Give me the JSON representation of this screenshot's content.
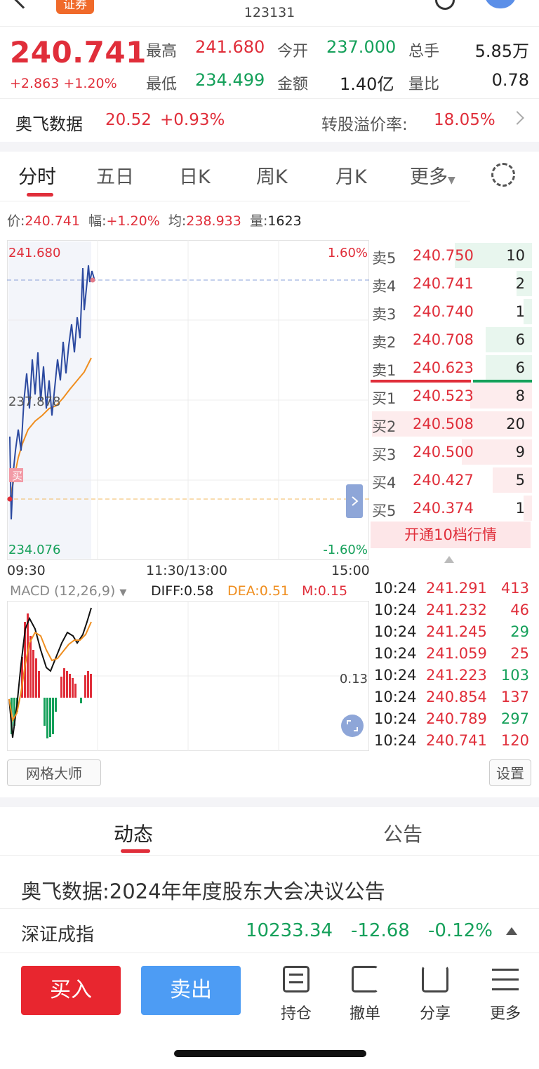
{
  "header": {
    "badge": "证券",
    "code": "123131"
  },
  "quote": {
    "price": "240.741",
    "change": "+2.863",
    "change_pct": "+1.20%",
    "high_label": "最高",
    "high": "241.680",
    "open_label": "今开",
    "open": "237.000",
    "vol_label": "总手",
    "vol": "5.85万",
    "low_label": "最低",
    "low": "234.499",
    "amt_label": "金额",
    "amt": "1.40亿",
    "ratio_label": "量比",
    "ratio": "0.78"
  },
  "underlying": {
    "name": "奥飞数据",
    "price": "20.52",
    "pct": "+0.93%",
    "premium_label": "转股溢价率:",
    "premium": "18.05%"
  },
  "tabs": [
    "分时",
    "五日",
    "日K",
    "周K",
    "月K",
    "更多"
  ],
  "info": {
    "price_label": "价:",
    "price": "240.741",
    "range_label": "幅:",
    "range": "+1.20%",
    "avg_label": "均:",
    "avg": "238.933",
    "vol_label": "量:",
    "vol": "1623"
  },
  "chart": {
    "top_price": "241.680",
    "top_pct": "1.60%",
    "mid_price": "237.878",
    "bottom_price": "234.076",
    "bottom_pct": "-1.60%",
    "buy_marker": "买",
    "t_start": "09:30",
    "t_mid": "11:30/13:00",
    "t_end": "15:00"
  },
  "macd": {
    "label": "MACD (12,26,9)",
    "diff": "DIFF:0.58",
    "dea": "DEA:0.51",
    "m": "M:0.15",
    "level": "0.13"
  },
  "orderbook": {
    "asks": [
      {
        "label": "卖5",
        "price": "240.750",
        "qty": "10"
      },
      {
        "label": "卖4",
        "price": "240.741",
        "qty": "2"
      },
      {
        "label": "卖3",
        "price": "240.740",
        "qty": "1"
      },
      {
        "label": "卖2",
        "price": "240.708",
        "qty": "6"
      },
      {
        "label": "卖1",
        "price": "240.623",
        "qty": "6"
      }
    ],
    "bids": [
      {
        "label": "买1",
        "price": "240.523",
        "qty": "8"
      },
      {
        "label": "买2",
        "price": "240.508",
        "qty": "20"
      },
      {
        "label": "买3",
        "price": "240.500",
        "qty": "9"
      },
      {
        "label": "买4",
        "price": "240.427",
        "qty": "5"
      },
      {
        "label": "买5",
        "price": "240.374",
        "qty": "1"
      }
    ],
    "upgrade": "开通10档行情"
  },
  "ticks": [
    {
      "time": "10:24",
      "price": "241.291",
      "vol": "413",
      "dir": "up"
    },
    {
      "time": "10:24",
      "price": "241.232",
      "vol": "46",
      "dir": "up"
    },
    {
      "time": "10:24",
      "price": "241.245",
      "vol": "29",
      "dir": "down"
    },
    {
      "time": "10:24",
      "price": "241.059",
      "vol": "25",
      "dir": "up"
    },
    {
      "time": "10:24",
      "price": "241.223",
      "vol": "103",
      "dir": "down"
    },
    {
      "time": "10:24",
      "price": "240.854",
      "vol": "137",
      "dir": "up"
    },
    {
      "time": "10:24",
      "price": "240.789",
      "vol": "297",
      "dir": "down"
    },
    {
      "time": "10:24",
      "price": "240.741",
      "vol": "120",
      "dir": "up"
    }
  ],
  "tools": {
    "grid": "网格大师",
    "settings": "设置"
  },
  "news_tabs": {
    "active": "动态",
    "other": "公告"
  },
  "news": {
    "headline": "奥飞数据:2024年年度股东大会决议公告"
  },
  "index": {
    "name": "深证成指",
    "value": "10233.34",
    "change": "-12.68",
    "pct": "-0.12%"
  },
  "bottom": {
    "buy": "买入",
    "sell": "卖出",
    "hold": "持仓",
    "cancel": "撤单",
    "share": "分享",
    "more": "更多"
  },
  "colors": {
    "up": "#e02e3a",
    "down": "#15a05a",
    "buy_btn": "#e8262f",
    "sell_btn": "#4d9cf4"
  }
}
